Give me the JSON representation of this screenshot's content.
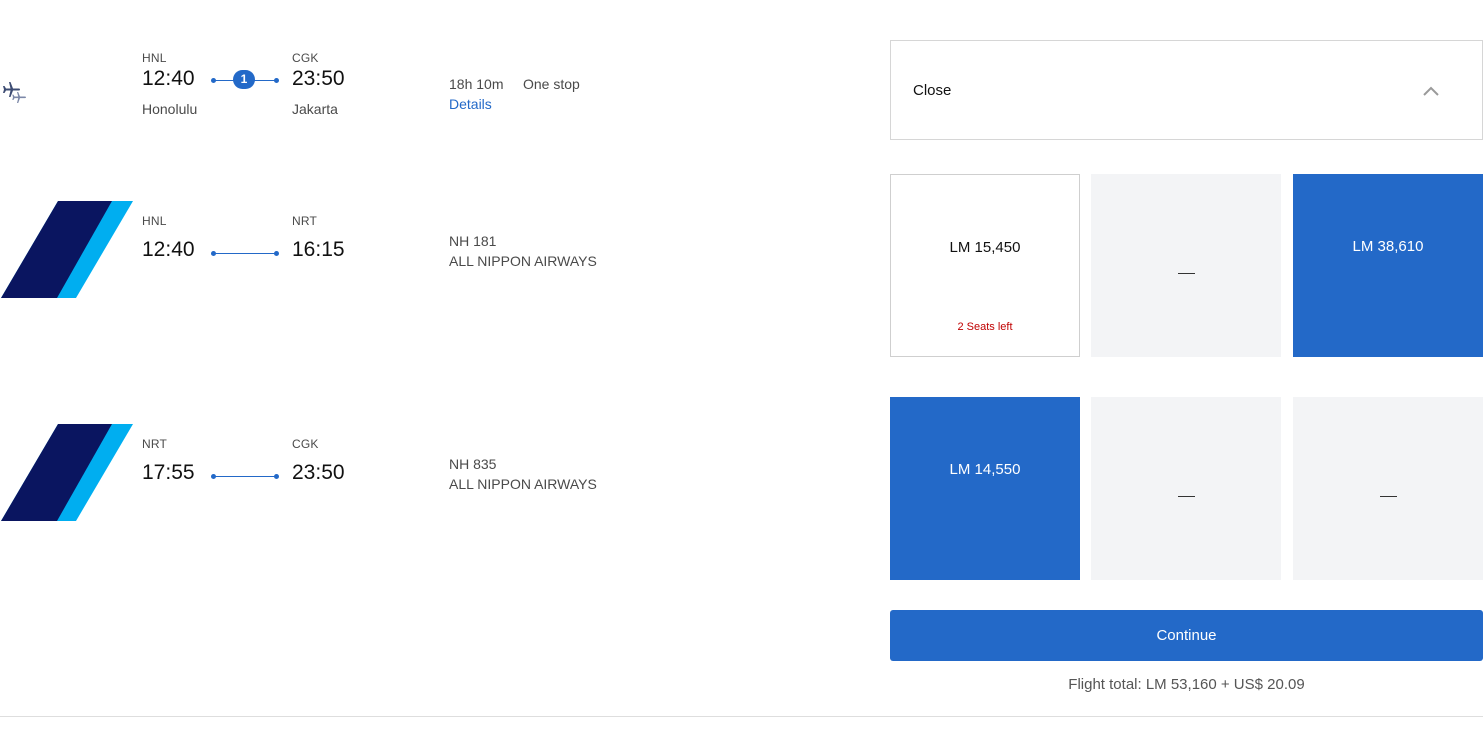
{
  "summary": {
    "origin_code": "HNL",
    "depart_time": "12:40",
    "origin_city": "Honolulu",
    "stops_count": "1",
    "dest_code": "CGK",
    "arrive_time": "23:50",
    "dest_city": "Jakarta",
    "duration": "18h 10m",
    "stops_label": "One stop",
    "details_link": "Details"
  },
  "segments": [
    {
      "from_code": "HNL",
      "depart_time": "12:40",
      "to_code": "NRT",
      "arrive_time": "16:15",
      "flight_number": "NH 181",
      "airline": "ALL NIPPON AIRWAYS"
    },
    {
      "from_code": "NRT",
      "depart_time": "17:55",
      "to_code": "CGK",
      "arrive_time": "23:50",
      "flight_number": "NH 835",
      "airline": "ALL NIPPON AIRWAYS"
    }
  ],
  "panel": {
    "close_label": "Close"
  },
  "fares": {
    "row1": {
      "col1_price": "LM 15,450",
      "col1_note": "2 Seats left",
      "col3_price": "LM 38,610"
    },
    "row2": {
      "col1_price": "LM 14,550"
    }
  },
  "continue_label": "Continue",
  "flight_total": "Flight total: LM 53,160 + US$ 20.09",
  "colors": {
    "accent": "#2369c8",
    "logo_navy": "#0a1560",
    "logo_cyan": "#00aef0",
    "seats_warning": "#c00000",
    "unavailable_bg": "#f3f4f6"
  }
}
